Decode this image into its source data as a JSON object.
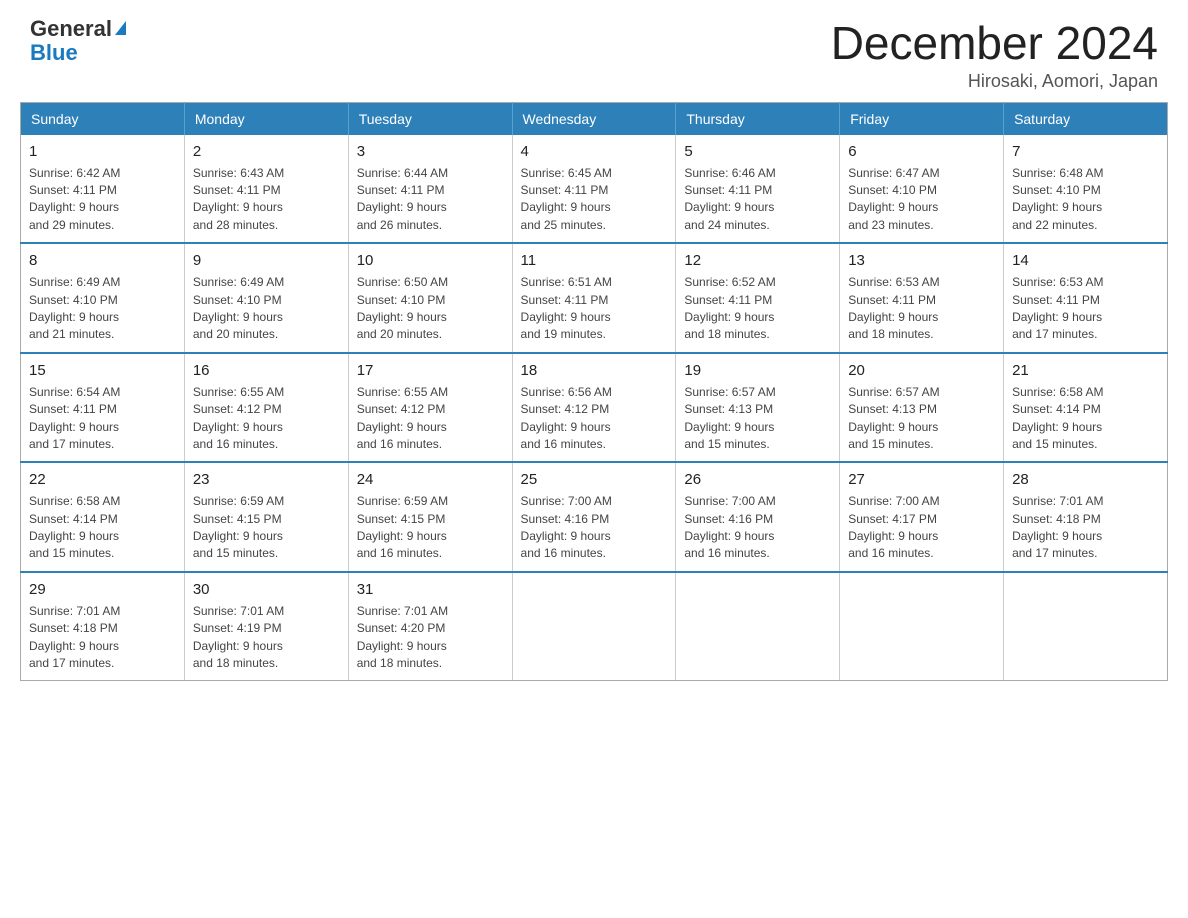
{
  "logo": {
    "general": "General",
    "blue": "Blue"
  },
  "title": "December 2024",
  "location": "Hirosaki, Aomori, Japan",
  "weekdays": [
    "Sunday",
    "Monday",
    "Tuesday",
    "Wednesday",
    "Thursday",
    "Friday",
    "Saturday"
  ],
  "weeks": [
    [
      {
        "day": "1",
        "info": "Sunrise: 6:42 AM\nSunset: 4:11 PM\nDaylight: 9 hours\nand 29 minutes."
      },
      {
        "day": "2",
        "info": "Sunrise: 6:43 AM\nSunset: 4:11 PM\nDaylight: 9 hours\nand 28 minutes."
      },
      {
        "day": "3",
        "info": "Sunrise: 6:44 AM\nSunset: 4:11 PM\nDaylight: 9 hours\nand 26 minutes."
      },
      {
        "day": "4",
        "info": "Sunrise: 6:45 AM\nSunset: 4:11 PM\nDaylight: 9 hours\nand 25 minutes."
      },
      {
        "day": "5",
        "info": "Sunrise: 6:46 AM\nSunset: 4:11 PM\nDaylight: 9 hours\nand 24 minutes."
      },
      {
        "day": "6",
        "info": "Sunrise: 6:47 AM\nSunset: 4:10 PM\nDaylight: 9 hours\nand 23 minutes."
      },
      {
        "day": "7",
        "info": "Sunrise: 6:48 AM\nSunset: 4:10 PM\nDaylight: 9 hours\nand 22 minutes."
      }
    ],
    [
      {
        "day": "8",
        "info": "Sunrise: 6:49 AM\nSunset: 4:10 PM\nDaylight: 9 hours\nand 21 minutes."
      },
      {
        "day": "9",
        "info": "Sunrise: 6:49 AM\nSunset: 4:10 PM\nDaylight: 9 hours\nand 20 minutes."
      },
      {
        "day": "10",
        "info": "Sunrise: 6:50 AM\nSunset: 4:10 PM\nDaylight: 9 hours\nand 20 minutes."
      },
      {
        "day": "11",
        "info": "Sunrise: 6:51 AM\nSunset: 4:11 PM\nDaylight: 9 hours\nand 19 minutes."
      },
      {
        "day": "12",
        "info": "Sunrise: 6:52 AM\nSunset: 4:11 PM\nDaylight: 9 hours\nand 18 minutes."
      },
      {
        "day": "13",
        "info": "Sunrise: 6:53 AM\nSunset: 4:11 PM\nDaylight: 9 hours\nand 18 minutes."
      },
      {
        "day": "14",
        "info": "Sunrise: 6:53 AM\nSunset: 4:11 PM\nDaylight: 9 hours\nand 17 minutes."
      }
    ],
    [
      {
        "day": "15",
        "info": "Sunrise: 6:54 AM\nSunset: 4:11 PM\nDaylight: 9 hours\nand 17 minutes."
      },
      {
        "day": "16",
        "info": "Sunrise: 6:55 AM\nSunset: 4:12 PM\nDaylight: 9 hours\nand 16 minutes."
      },
      {
        "day": "17",
        "info": "Sunrise: 6:55 AM\nSunset: 4:12 PM\nDaylight: 9 hours\nand 16 minutes."
      },
      {
        "day": "18",
        "info": "Sunrise: 6:56 AM\nSunset: 4:12 PM\nDaylight: 9 hours\nand 16 minutes."
      },
      {
        "day": "19",
        "info": "Sunrise: 6:57 AM\nSunset: 4:13 PM\nDaylight: 9 hours\nand 15 minutes."
      },
      {
        "day": "20",
        "info": "Sunrise: 6:57 AM\nSunset: 4:13 PM\nDaylight: 9 hours\nand 15 minutes."
      },
      {
        "day": "21",
        "info": "Sunrise: 6:58 AM\nSunset: 4:14 PM\nDaylight: 9 hours\nand 15 minutes."
      }
    ],
    [
      {
        "day": "22",
        "info": "Sunrise: 6:58 AM\nSunset: 4:14 PM\nDaylight: 9 hours\nand 15 minutes."
      },
      {
        "day": "23",
        "info": "Sunrise: 6:59 AM\nSunset: 4:15 PM\nDaylight: 9 hours\nand 15 minutes."
      },
      {
        "day": "24",
        "info": "Sunrise: 6:59 AM\nSunset: 4:15 PM\nDaylight: 9 hours\nand 16 minutes."
      },
      {
        "day": "25",
        "info": "Sunrise: 7:00 AM\nSunset: 4:16 PM\nDaylight: 9 hours\nand 16 minutes."
      },
      {
        "day": "26",
        "info": "Sunrise: 7:00 AM\nSunset: 4:16 PM\nDaylight: 9 hours\nand 16 minutes."
      },
      {
        "day": "27",
        "info": "Sunrise: 7:00 AM\nSunset: 4:17 PM\nDaylight: 9 hours\nand 16 minutes."
      },
      {
        "day": "28",
        "info": "Sunrise: 7:01 AM\nSunset: 4:18 PM\nDaylight: 9 hours\nand 17 minutes."
      }
    ],
    [
      {
        "day": "29",
        "info": "Sunrise: 7:01 AM\nSunset: 4:18 PM\nDaylight: 9 hours\nand 17 minutes."
      },
      {
        "day": "30",
        "info": "Sunrise: 7:01 AM\nSunset: 4:19 PM\nDaylight: 9 hours\nand 18 minutes."
      },
      {
        "day": "31",
        "info": "Sunrise: 7:01 AM\nSunset: 4:20 PM\nDaylight: 9 hours\nand 18 minutes."
      },
      {
        "day": "",
        "info": ""
      },
      {
        "day": "",
        "info": ""
      },
      {
        "day": "",
        "info": ""
      },
      {
        "day": "",
        "info": ""
      }
    ]
  ]
}
